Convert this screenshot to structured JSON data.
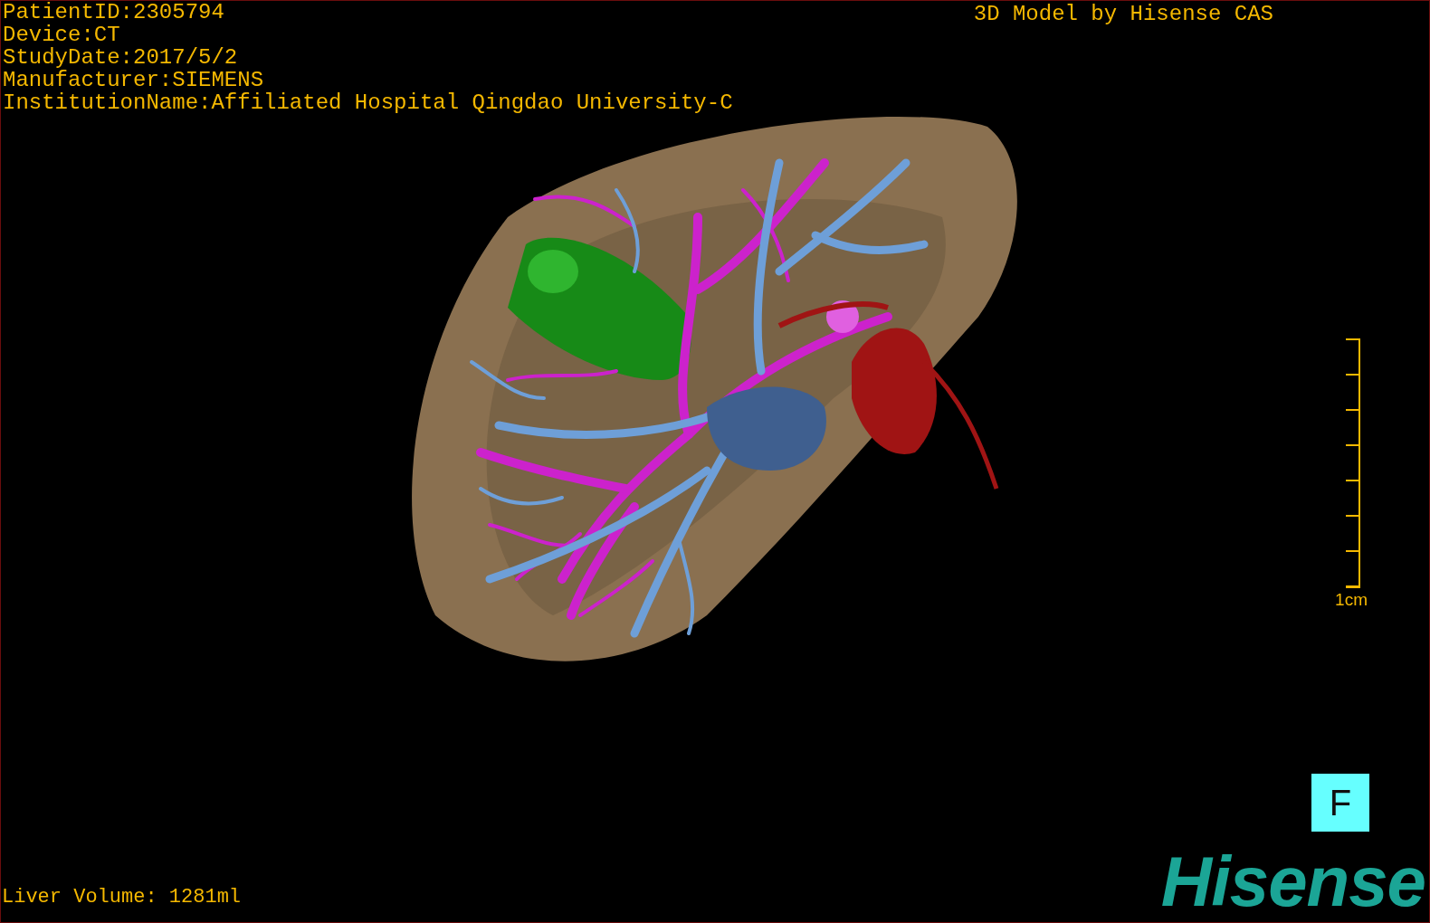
{
  "study_info": [
    "PatientID:2305794",
    "Device:CT",
    "StudyDate:2017/5/2",
    "Manufacturer:SIEMENS",
    "InstitutionName:Affiliated Hospital Qingdao University-C"
  ],
  "title": "3D Model by Hisense CAS",
  "scale_bar": {
    "label": "1cm"
  },
  "orientation_button": "F",
  "volume": "Liver Volume: 1281ml",
  "logo": "Hisense"
}
